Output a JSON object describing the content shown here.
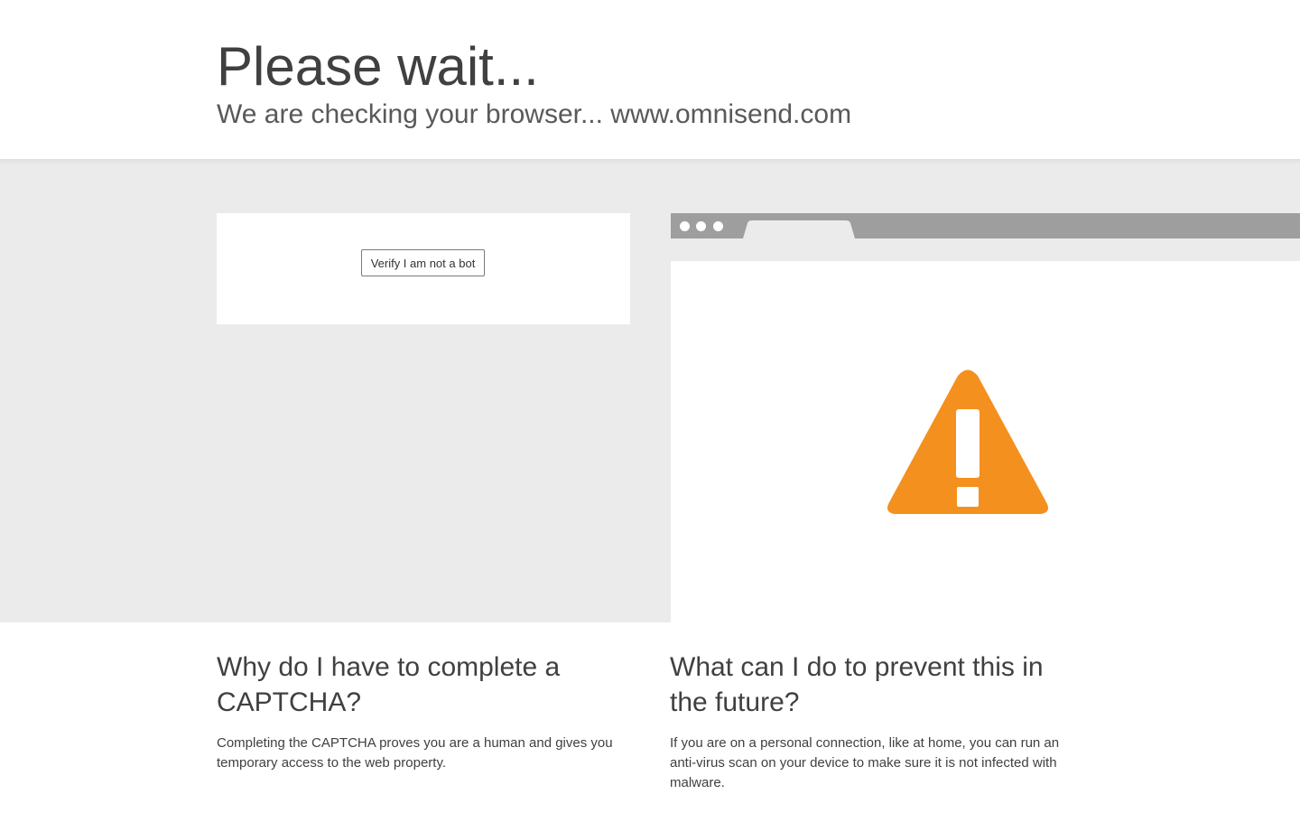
{
  "header": {
    "title": "Please wait...",
    "subtitle": "We are checking your browser... www.omnisend.com"
  },
  "captcha": {
    "verify_label": "Verify I am not a bot"
  },
  "illustration": {
    "icon": "warning-icon",
    "warning_color": "#f4901e",
    "bar_color": "#9e9e9e"
  },
  "info": {
    "why": {
      "heading": "Why do I have to complete a CAPTCHA?",
      "text": "Completing the CAPTCHA proves you are a human and gives you temporary access to the web property."
    },
    "prevent": {
      "heading": "What can I do to prevent this in the future?",
      "text": "If you are on a personal connection, like at home, you can run an anti-virus scan on your device to make sure it is not infected with malware."
    }
  }
}
